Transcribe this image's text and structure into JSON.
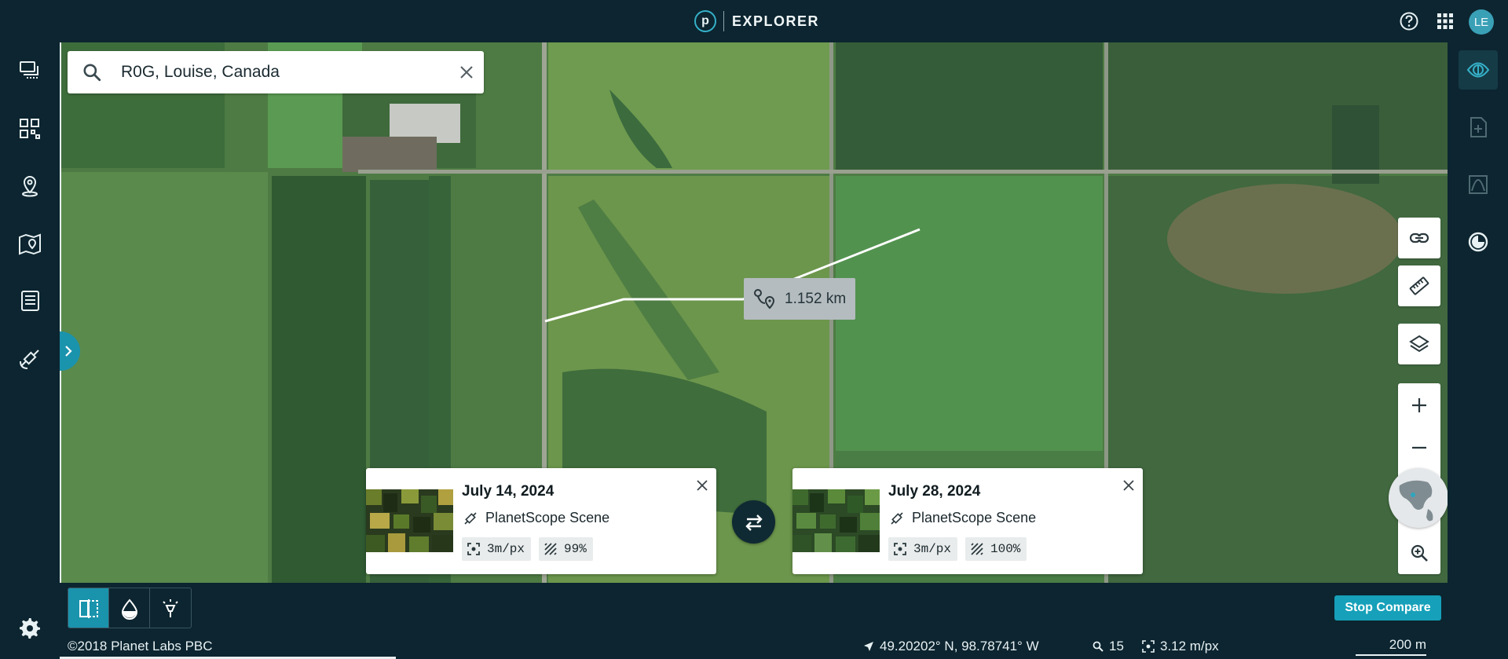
{
  "header": {
    "logo_letter": "p",
    "app_name": "EXPLORER",
    "user_initials": "LE"
  },
  "left_sidebar": {
    "items": [
      {
        "name": "scenes-stack-icon"
      },
      {
        "name": "mosaic-grid-icon"
      },
      {
        "name": "location-pin-icon"
      },
      {
        "name": "map-pin-icon"
      },
      {
        "name": "document-list-icon"
      },
      {
        "name": "satellite-icon"
      }
    ],
    "settings": "gear-icon"
  },
  "search": {
    "value": "R0G, Louise, Canada"
  },
  "measurement": {
    "label": "1.152 km"
  },
  "compare": {
    "left": {
      "date": "July 14, 2024",
      "type": "PlanetScope Scene",
      "resolution": "3m/px",
      "coverage": "99%"
    },
    "right": {
      "date": "July 28, 2024",
      "type": "PlanetScope Scene",
      "resolution": "3m/px",
      "coverage": "100%"
    }
  },
  "toolbar": {
    "stop_compare_label": "Stop Compare"
  },
  "status": {
    "copyright": "©2018 Planet Labs PBC",
    "coordinates": "49.20202° N, 98.78741° W",
    "zoom_level": "15",
    "resolution": "3.12 m/px",
    "scale": "200 m"
  },
  "colors": {
    "background": "#0c2530",
    "accent": "#16a0b9",
    "field_green": "#4d7a45"
  }
}
